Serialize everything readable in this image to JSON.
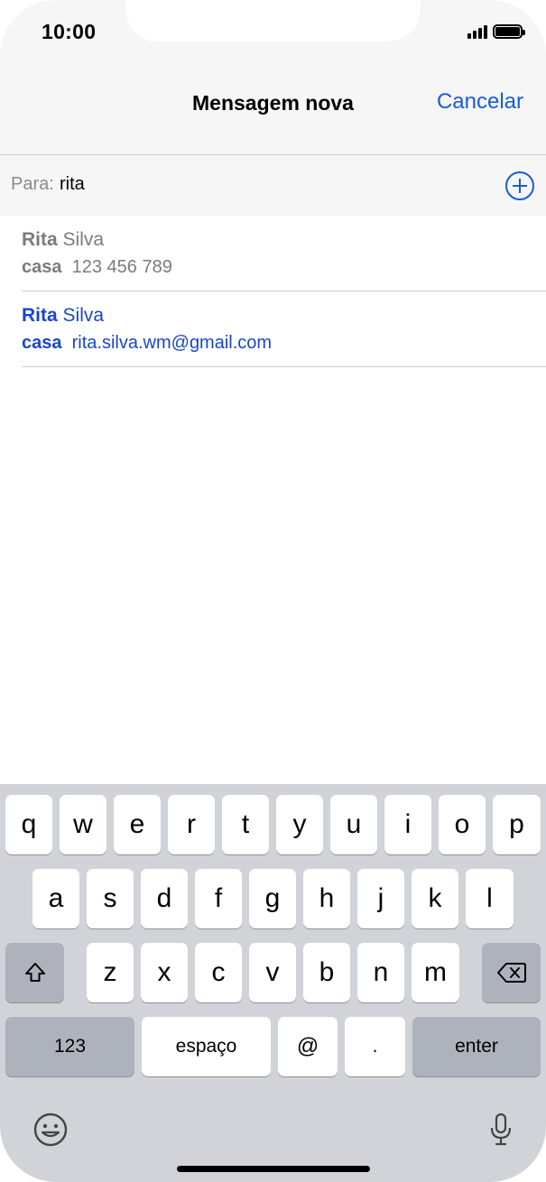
{
  "status": {
    "time": "10:00"
  },
  "nav": {
    "title": "Mensagem nova",
    "cancel": "Cancelar"
  },
  "to_field": {
    "label": "Para:",
    "value": "rita"
  },
  "suggestions": [
    {
      "first": "Rita",
      "last": "Silva",
      "type": "casa",
      "value": "123 456 789",
      "color": "#7b7b7f"
    },
    {
      "first": "Rita",
      "last": "Silva",
      "type": "casa",
      "value": "rita.silva.wm@gmail.com",
      "color": "#1a46c8"
    }
  ],
  "keyboard": {
    "row1": [
      "q",
      "w",
      "e",
      "r",
      "t",
      "y",
      "u",
      "i",
      "o",
      "p"
    ],
    "row2": [
      "a",
      "s",
      "d",
      "f",
      "g",
      "h",
      "j",
      "k",
      "l"
    ],
    "row3": [
      "z",
      "x",
      "c",
      "v",
      "b",
      "n",
      "m"
    ],
    "numbers": "123",
    "space": "espaço",
    "at": "@",
    "dot": ".",
    "enter": "enter",
    "shift_icon": "shift-icon",
    "delete_icon": "delete-icon",
    "emoji_icon": "emoji-icon",
    "mic_icon": "microphone-icon"
  },
  "colors": {
    "accent": "#1a5bd8",
    "keyboard_bg": "#d1d3d9",
    "header_bg": "#f6f6f6"
  }
}
